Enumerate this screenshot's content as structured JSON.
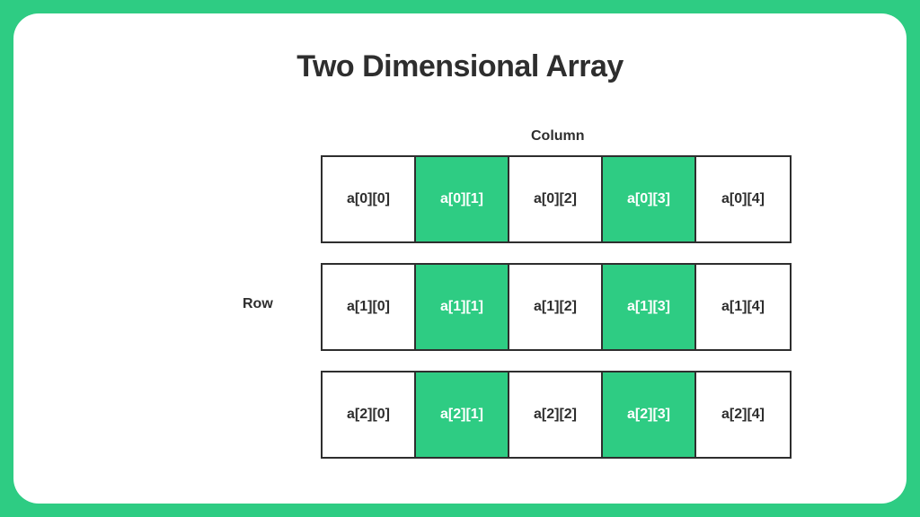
{
  "title": "Two Dimensional Array",
  "labels": {
    "column": "Column",
    "row": "Row"
  },
  "colors": {
    "accent": "#2ecc83",
    "text": "#2e2e2e"
  },
  "grid": {
    "rows": 3,
    "cols": 5,
    "highlighted_cols": [
      1,
      3
    ],
    "cells": [
      [
        "a[0][0]",
        "a[0][1]",
        "a[0][2]",
        "a[0][3]",
        "a[0][4]"
      ],
      [
        "a[1][0]",
        "a[1][1]",
        "a[1][2]",
        "a[1][3]",
        "a[1][4]"
      ],
      [
        "a[2][0]",
        "a[2][1]",
        "a[2][2]",
        "a[2][3]",
        "a[2][4]"
      ]
    ]
  }
}
